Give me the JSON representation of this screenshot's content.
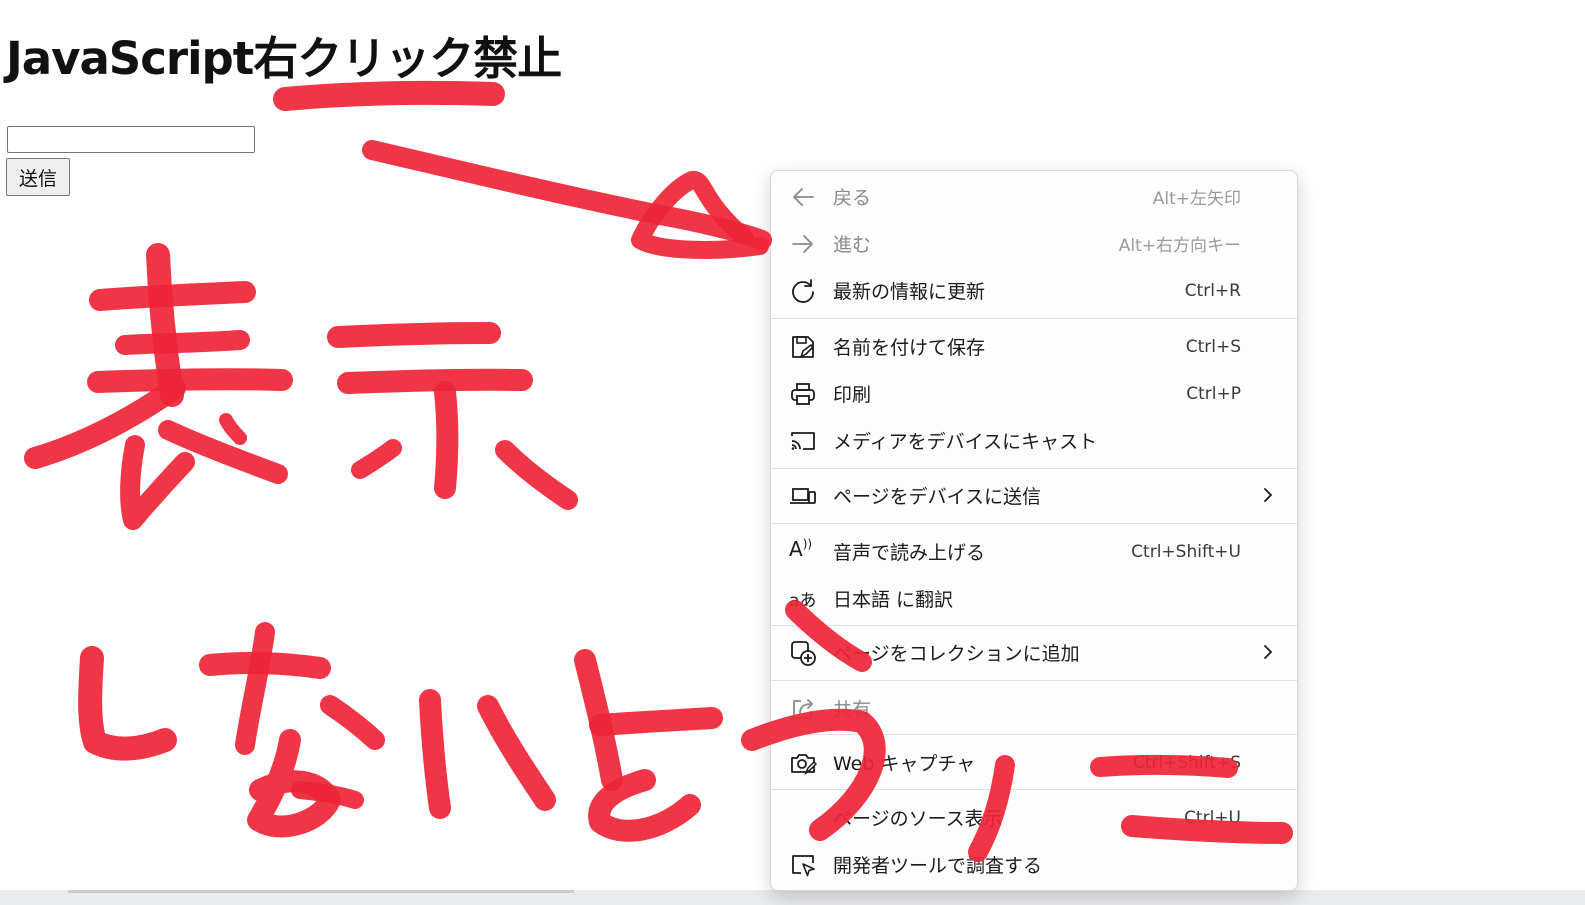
{
  "page": {
    "title": "JavaScript右クリック禁止",
    "input_value": "",
    "submit_label": "送信"
  },
  "context_menu": {
    "items": [
      {
        "label": "戻る",
        "shortcut": "Alt+左矢印",
        "icon": "back-arrow-icon",
        "disabled": true
      },
      {
        "label": "進む",
        "shortcut": "Alt+右方向キー",
        "icon": "forward-arrow-icon",
        "disabled": true
      },
      {
        "label": "最新の情報に更新",
        "shortcut": "Ctrl+R",
        "icon": "refresh-icon"
      },
      {
        "label": "名前を付けて保存",
        "shortcut": "Ctrl+S",
        "icon": "save-icon"
      },
      {
        "label": "印刷",
        "shortcut": "Ctrl+P",
        "icon": "print-icon"
      },
      {
        "label": "メディアをデバイスにキャスト",
        "shortcut": "",
        "icon": "cast-icon"
      },
      {
        "label": "ページをデバイスに送信",
        "shortcut": "",
        "icon": "send-to-device-icon",
        "submenu": true
      },
      {
        "label": "音声で読み上げる",
        "shortcut": "Ctrl+Shift+U",
        "icon": "read-aloud-icon"
      },
      {
        "label": "日本語 に翻訳",
        "shortcut": "",
        "icon": "translate-icon"
      },
      {
        "label": "ページをコレクションに追加",
        "shortcut": "",
        "icon": "collections-add-icon",
        "submenu": true
      },
      {
        "label": "共有",
        "shortcut": "",
        "icon": "share-icon"
      },
      {
        "label": "Web キャプチャ",
        "shortcut": "Ctrl+Shift+S",
        "icon": "web-capture-icon"
      },
      {
        "label": "ページのソース表示",
        "shortcut": "Ctrl+U",
        "icon": "view-source-icon"
      },
      {
        "label": "開発者ツールで調査する",
        "shortcut": "",
        "icon": "devtools-inspect-icon"
      }
    ],
    "icon_glyphs": {
      "read_aloud": "A",
      "translate": "aあ"
    }
  },
  "annotation": {
    "handwritten_text": "表示しないようにー",
    "color": "#ee2436"
  }
}
